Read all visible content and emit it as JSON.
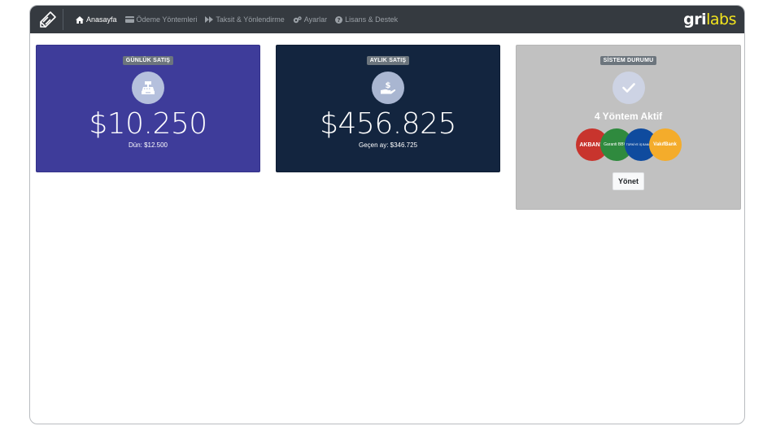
{
  "nav": {
    "items": [
      {
        "label": "Anasayfa",
        "icon": "home-icon",
        "active": true
      },
      {
        "label": "Ödeme Yöntemleri",
        "icon": "credit-card-icon",
        "active": false
      },
      {
        "label": "Taksit & Yönlendirme",
        "icon": "forward-icon",
        "active": false
      },
      {
        "label": "Ayarlar",
        "icon": "gears-icon",
        "active": false
      },
      {
        "label": "Lisans & Destek",
        "icon": "question-circle-icon",
        "active": false
      }
    ],
    "logo": {
      "part1": "gri",
      "part2": "labs"
    }
  },
  "cards": {
    "daily": {
      "badge": "GÜNLÜK SATIŞ",
      "icon": "cash-register-icon",
      "amount": "$10.250",
      "sub": "Dün: $12.500",
      "color": "#3e3c9a"
    },
    "monthly": {
      "badge": "AYLIK SATIŞ",
      "icon": "hand-dollar-icon",
      "amount": "$456.825",
      "sub": "Geçen ay: $346.725",
      "color": "#13253f"
    },
    "status": {
      "badge": "SİSTEM DURUMU",
      "icon": "check-icon",
      "title": "4 Yöntem Aktif",
      "banks": [
        {
          "label": "AKBANK",
          "color": "#c8342d"
        },
        {
          "label": "Garanti BBVA",
          "color": "#2f8a3e"
        },
        {
          "label": "TÜRKİYE İŞ BANKASI",
          "color": "#0f4b9e"
        },
        {
          "label": "VakıfBank",
          "color": "#f4ac2b"
        }
      ],
      "button": "Yönet",
      "color": "#c1c1c1"
    }
  }
}
